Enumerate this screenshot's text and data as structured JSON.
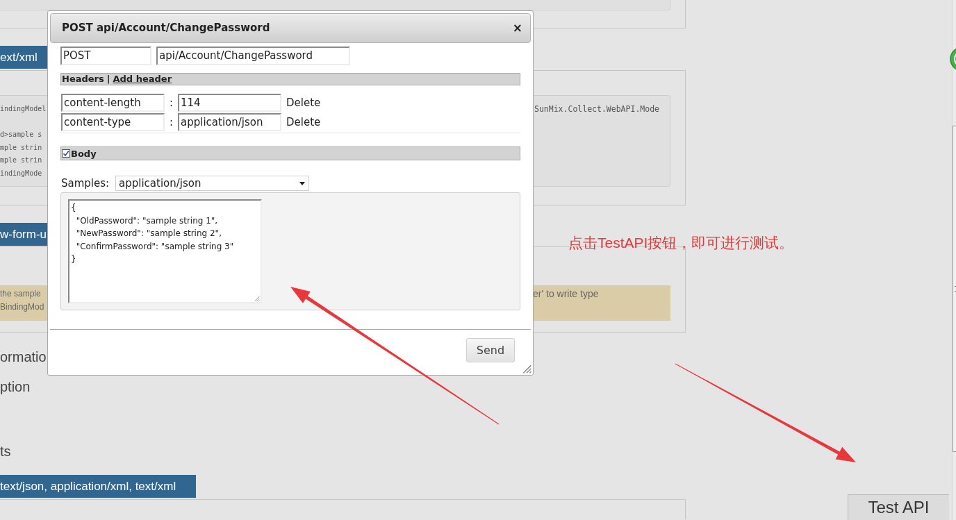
{
  "page": {
    "sections": [
      {
        "kind": "badge",
        "text": "ext/xml"
      },
      {
        "kind": "code",
        "lines": [
          "indingModel",
          "d>sample s",
          "mple strin",
          "mple strin",
          "indingMode"
        ],
        "right": "SunMix.Collect.WebAPI.Mode"
      },
      {
        "kind": "badge",
        "text": "w-form-u"
      },
      {
        "kind": "note",
        "lines": [
          "the sample",
          "BindingMod"
        ],
        "right": "er' to write type"
      },
      {
        "kind": "heading",
        "text": "ormatio"
      },
      {
        "kind": "label",
        "text": "ption"
      },
      {
        "kind": "label",
        "text": "ts"
      },
      {
        "kind": "badge",
        "text": "text/json, application/xml, text/xml"
      }
    ]
  },
  "dialog": {
    "title": "POST api/Account/ChangePassword",
    "close": "×",
    "method": "POST",
    "url": "api/Account/ChangePassword",
    "headers_bar": {
      "title": "Headers",
      "separator": "|",
      "link": "Add header"
    },
    "headers": [
      {
        "name": "content-length",
        "separator": ":",
        "value": "114",
        "action": "Delete"
      },
      {
        "name": "content-type",
        "separator": ":",
        "value": "application/json",
        "action": "Delete"
      }
    ],
    "body": {
      "label": "Body",
      "checked": true
    },
    "samples": {
      "label": "Samples:",
      "value": "application/json"
    },
    "body_text": "{\n  \"OldPassword\": \"sample string 1\",\n  \"NewPassword\": \"sample string 2\",\n  \"ConfirmPassword\": \"sample string 3\"\n}",
    "send": "Send"
  },
  "annotation": {
    "text": "点击TestAPI按钮，即可进行测试。"
  },
  "test_api_button": "Test API"
}
